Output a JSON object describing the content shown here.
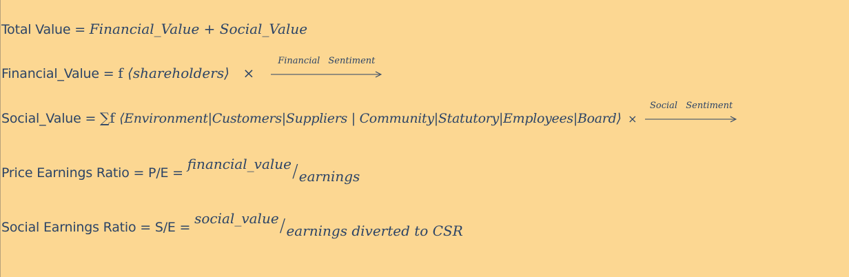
{
  "line1": {
    "label": "Total Value = ",
    "formula": "Financial_Value + Social_Value"
  },
  "line2": {
    "label": "Financial_Value = ",
    "func": "f ",
    "formula": "⟨shareholders⟩",
    "times": "×",
    "arrow_label": "Financial Sentiment"
  },
  "line3": {
    "label": "Social_Value = ",
    "sum": "∑f ",
    "formula": "⟨Environment|Customers|Suppliers | Community|Statutory|Employees|Board⟩",
    "times": "×",
    "arrow_label": "Social Sentiment"
  },
  "line4": {
    "label": "Price Earnings Ratio = P/E = ",
    "numerator": "financial_value",
    "slash": "/",
    "denominator": "earnings"
  },
  "line5": {
    "label": "Social Earnings Ratio = S/E = ",
    "numerator": "social_value",
    "slash": "/",
    "denominator": "earnings diverted to CSR"
  }
}
